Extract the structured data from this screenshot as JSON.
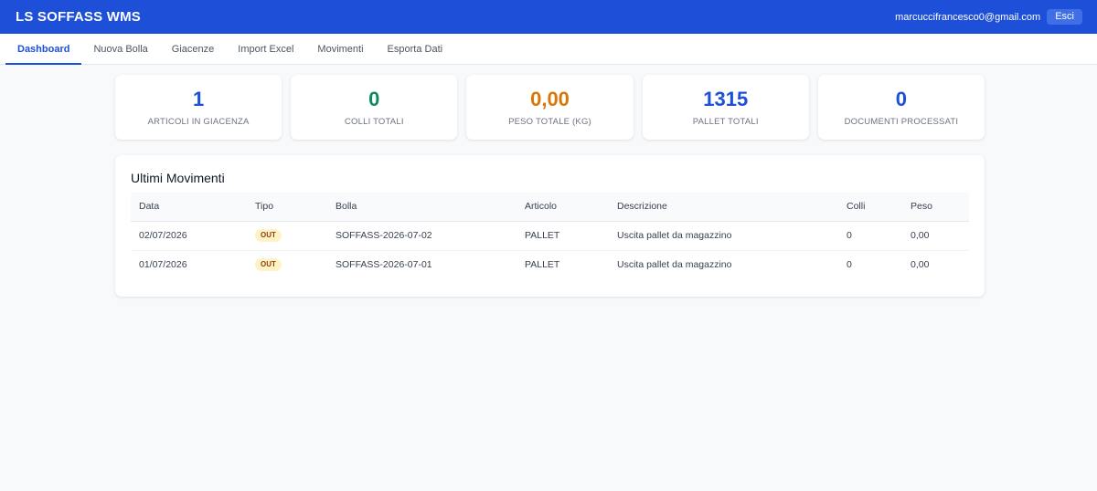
{
  "header": {
    "title": "LS SOFFASS WMS",
    "user_email": "marcuccifrancesco0@gmail.com",
    "logout_label": "Esci",
    "color": "#1d4fd8"
  },
  "nav": {
    "tabs": [
      {
        "label": "Dashboard",
        "active": true
      },
      {
        "label": "Nuova Bolla",
        "active": false
      },
      {
        "label": "Giacenze",
        "active": false
      },
      {
        "label": "Import Excel",
        "active": false
      },
      {
        "label": "Movimenti",
        "active": false
      },
      {
        "label": "Esporta Dati",
        "active": false
      }
    ]
  },
  "stats": [
    {
      "value": "1",
      "label": "Articoli in giacenza",
      "color": "#1d4fd8"
    },
    {
      "value": "0",
      "label": "Colli totali",
      "color": "#0f8a5f"
    },
    {
      "value": "0,00",
      "label": "Peso totale (kg)",
      "color": "#d97706"
    },
    {
      "value": "1315",
      "label": "Pallet totali",
      "color": "#1d4fd8"
    },
    {
      "value": "0",
      "label": "Documenti processati",
      "color": "#1d4fd8"
    }
  ],
  "movements": {
    "title": "Ultimi Movimenti",
    "columns": [
      "Data",
      "Tipo",
      "Bolla",
      "Articolo",
      "Descrizione",
      "Colli",
      "Peso"
    ],
    "rows": [
      [
        "02/07/2026",
        "OUT",
        "SOFFASS-2026-07-02",
        "PALLET",
        "Uscita pallet da magazzino",
        "0",
        "0,00"
      ],
      [
        "01/07/2026",
        "OUT",
        "SOFFASS-2026-07-01",
        "PALLET",
        "Uscita pallet da magazzino",
        "0",
        "0,00"
      ]
    ]
  }
}
